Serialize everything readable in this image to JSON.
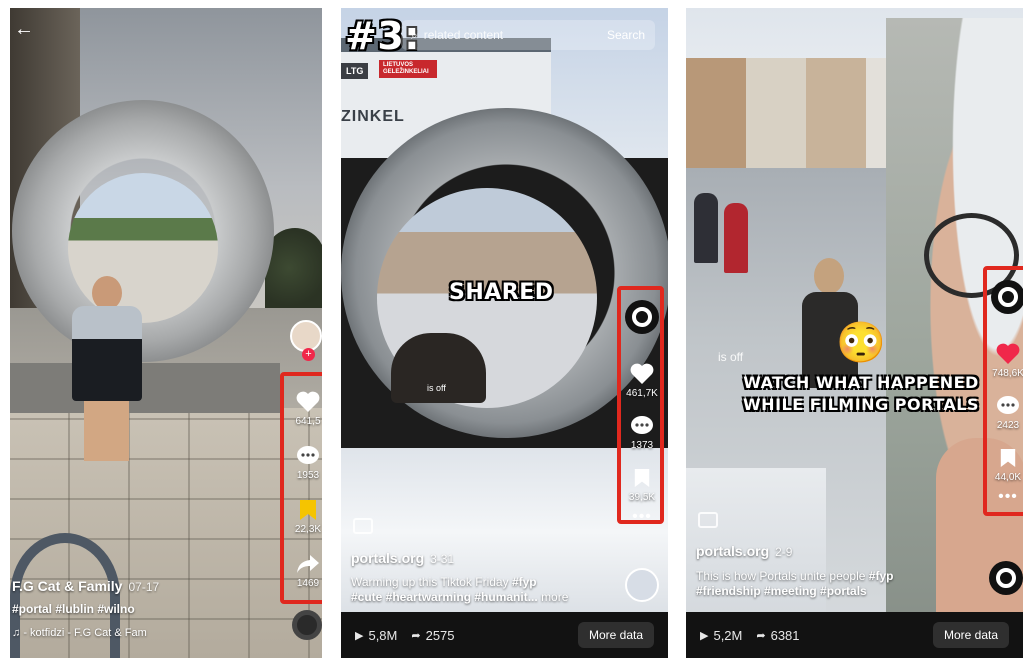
{
  "panels": [
    {
      "username": "F.G Cat & Family",
      "date": "07-17",
      "hashtags": "#portal #lublin #wilno",
      "sound": "- kotfidzi - F.G Cat & Fam",
      "likes": "641,5",
      "comments": "1953",
      "saves": "22,3K",
      "shares": "1469"
    },
    {
      "title_overlay": "#3:",
      "search_placeholder": "related content",
      "search_button": "Search",
      "sign_text": "LTG",
      "sign_text_2": "LIETUVOS GELEŽINKELIAI",
      "banner_text": "ZINKEL",
      "center_caption": "SHARED",
      "inner_text": "is off",
      "username": "portals.org",
      "date": "3-31",
      "caption": "Warming up this Tiktok Friday",
      "caption_tag": "#fyp",
      "hashtags": "#cute #heartwarming #humanit...",
      "more_link": "more",
      "likes": "461,7K",
      "comments": "1373",
      "saves": "39,5K",
      "views": "5,8M",
      "shares_total": "2575",
      "more_data": "More data"
    },
    {
      "emoji": "😳",
      "overlay_line1": "WATCH WHAT HAPPENED",
      "overlay_line2": "WHILE FILMING PORTALS",
      "inner_text": "is off",
      "username": "portals.org",
      "date": "2-9",
      "caption": "This is how Portals unite people",
      "caption_tag": "#fyp",
      "hashtags": "#friendship #meeting #portals",
      "likes": "748,6K",
      "comments": "2423",
      "saves": "44,0K",
      "views": "5,2M",
      "shares_total": "6381",
      "more_data": "More data"
    }
  ],
  "colors": {
    "highlight_box": "#e0281e",
    "like_red": "#f0284a",
    "save_yellow": "#f5c400"
  },
  "icons": [
    "back-arrow-icon",
    "heart-icon",
    "comment-icon",
    "bookmark-icon",
    "share-icon",
    "record-icon",
    "play-icon",
    "caption-icon",
    "search-icon",
    "music-icon"
  ]
}
